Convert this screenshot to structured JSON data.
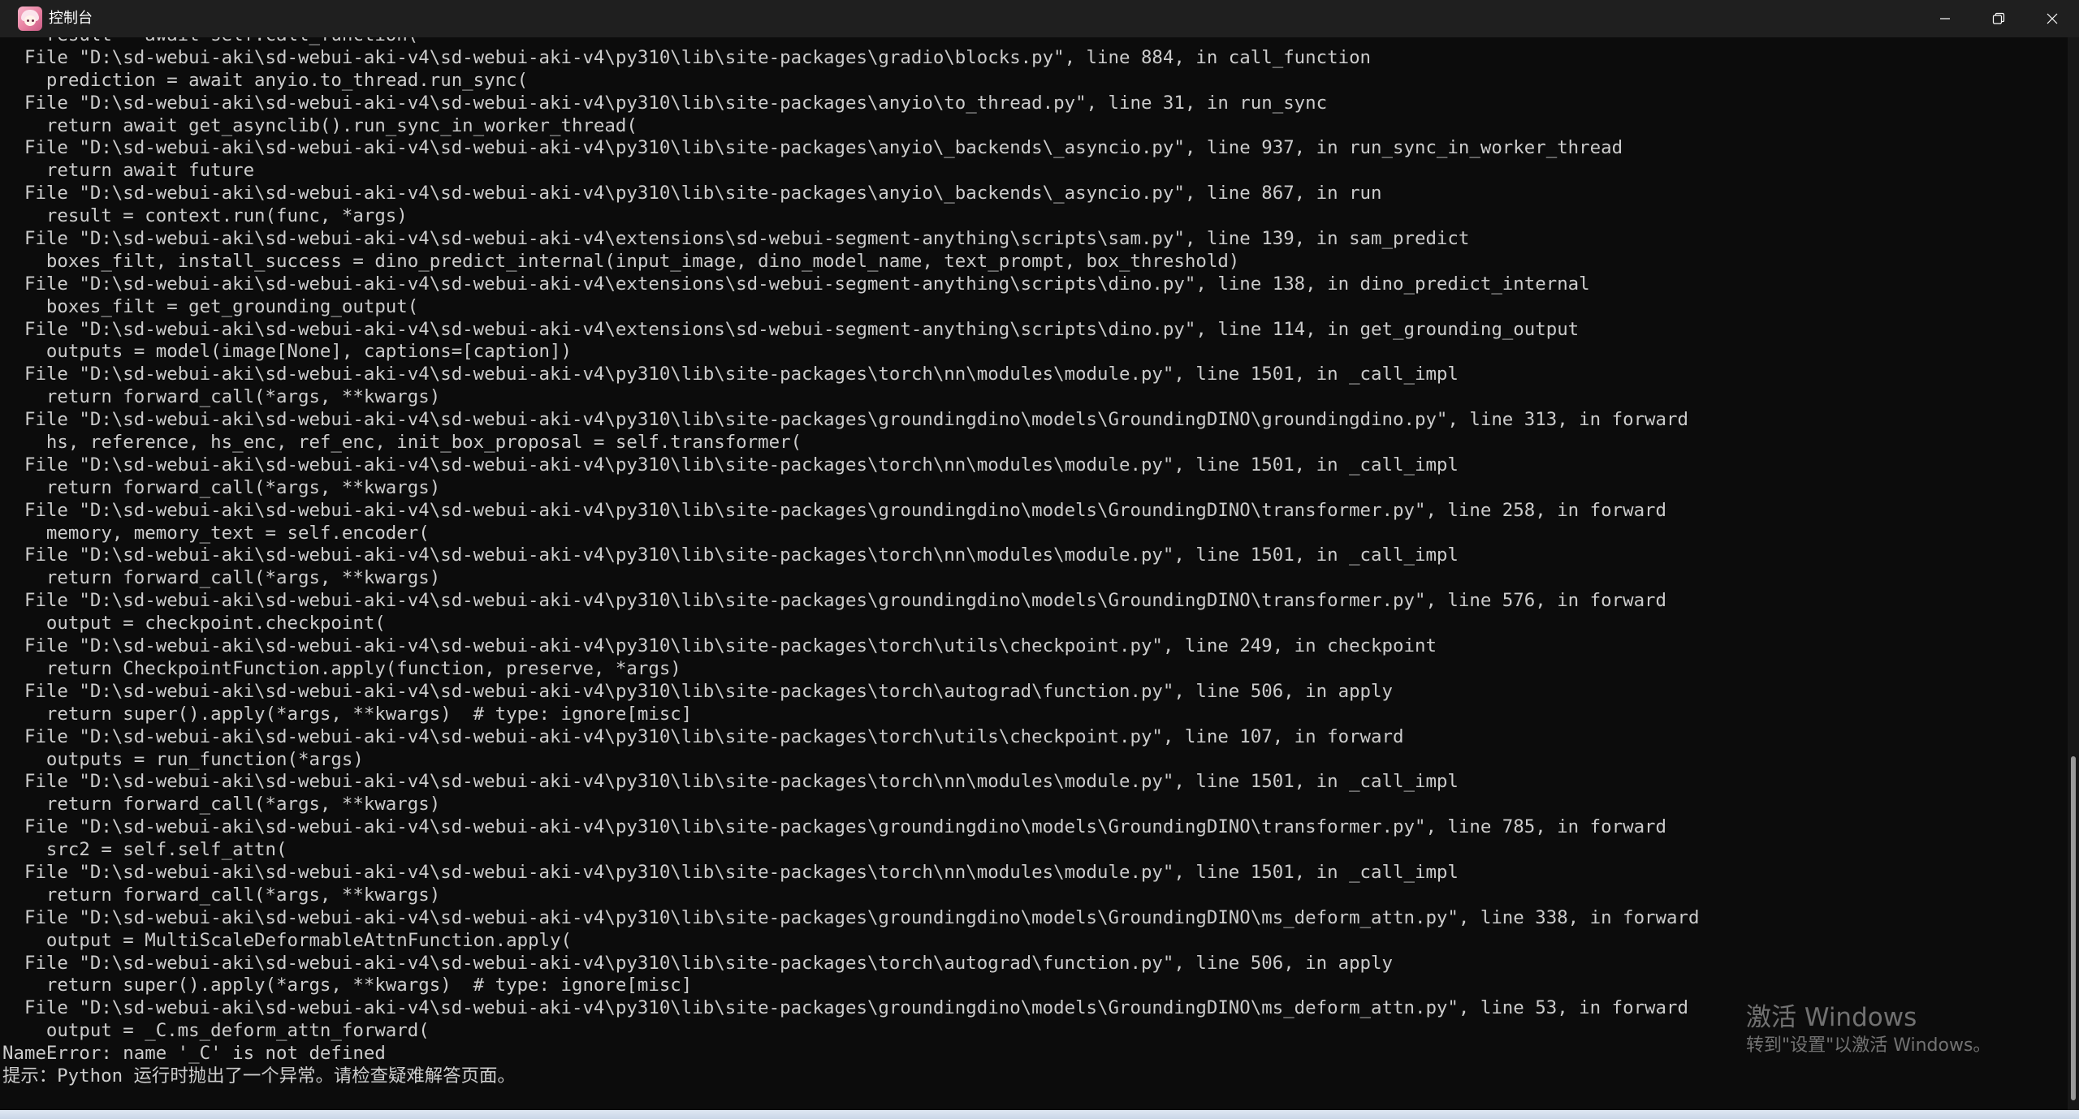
{
  "window": {
    "title": "控制台",
    "app_icon": "anime-avatar-icon",
    "controls": {
      "minimize": "minimize-icon",
      "maximize": "restore-icon",
      "close": "close-icon"
    }
  },
  "console": {
    "lines": [
      "    result = await self.call_function(",
      "  File \"D:\\sd-webui-aki\\sd-webui-aki-v4\\sd-webui-aki-v4\\py310\\lib\\site-packages\\gradio\\blocks.py\", line 884, in call_function",
      "    prediction = await anyio.to_thread.run_sync(",
      "  File \"D:\\sd-webui-aki\\sd-webui-aki-v4\\sd-webui-aki-v4\\py310\\lib\\site-packages\\anyio\\to_thread.py\", line 31, in run_sync",
      "    return await get_asynclib().run_sync_in_worker_thread(",
      "  File \"D:\\sd-webui-aki\\sd-webui-aki-v4\\sd-webui-aki-v4\\py310\\lib\\site-packages\\anyio\\_backends\\_asyncio.py\", line 937, in run_sync_in_worker_thread",
      "    return await future",
      "  File \"D:\\sd-webui-aki\\sd-webui-aki-v4\\sd-webui-aki-v4\\py310\\lib\\site-packages\\anyio\\_backends\\_asyncio.py\", line 867, in run",
      "    result = context.run(func, *args)",
      "  File \"D:\\sd-webui-aki\\sd-webui-aki-v4\\sd-webui-aki-v4\\extensions\\sd-webui-segment-anything\\scripts\\sam.py\", line 139, in sam_predict",
      "    boxes_filt, install_success = dino_predict_internal(input_image, dino_model_name, text_prompt, box_threshold)",
      "  File \"D:\\sd-webui-aki\\sd-webui-aki-v4\\sd-webui-aki-v4\\extensions\\sd-webui-segment-anything\\scripts\\dino.py\", line 138, in dino_predict_internal",
      "    boxes_filt = get_grounding_output(",
      "  File \"D:\\sd-webui-aki\\sd-webui-aki-v4\\sd-webui-aki-v4\\extensions\\sd-webui-segment-anything\\scripts\\dino.py\", line 114, in get_grounding_output",
      "    outputs = model(image[None], captions=[caption])",
      "  File \"D:\\sd-webui-aki\\sd-webui-aki-v4\\sd-webui-aki-v4\\py310\\lib\\site-packages\\torch\\nn\\modules\\module.py\", line 1501, in _call_impl",
      "    return forward_call(*args, **kwargs)",
      "  File \"D:\\sd-webui-aki\\sd-webui-aki-v4\\sd-webui-aki-v4\\py310\\lib\\site-packages\\groundingdino\\models\\GroundingDINO\\groundingdino.py\", line 313, in forward",
      "    hs, reference, hs_enc, ref_enc, init_box_proposal = self.transformer(",
      "  File \"D:\\sd-webui-aki\\sd-webui-aki-v4\\sd-webui-aki-v4\\py310\\lib\\site-packages\\torch\\nn\\modules\\module.py\", line 1501, in _call_impl",
      "    return forward_call(*args, **kwargs)",
      "  File \"D:\\sd-webui-aki\\sd-webui-aki-v4\\sd-webui-aki-v4\\py310\\lib\\site-packages\\groundingdino\\models\\GroundingDINO\\transformer.py\", line 258, in forward",
      "    memory, memory_text = self.encoder(",
      "  File \"D:\\sd-webui-aki\\sd-webui-aki-v4\\sd-webui-aki-v4\\py310\\lib\\site-packages\\torch\\nn\\modules\\module.py\", line 1501, in _call_impl",
      "    return forward_call(*args, **kwargs)",
      "  File \"D:\\sd-webui-aki\\sd-webui-aki-v4\\sd-webui-aki-v4\\py310\\lib\\site-packages\\groundingdino\\models\\GroundingDINO\\transformer.py\", line 576, in forward",
      "    output = checkpoint.checkpoint(",
      "  File \"D:\\sd-webui-aki\\sd-webui-aki-v4\\sd-webui-aki-v4\\py310\\lib\\site-packages\\torch\\utils\\checkpoint.py\", line 249, in checkpoint",
      "    return CheckpointFunction.apply(function, preserve, *args)",
      "  File \"D:\\sd-webui-aki\\sd-webui-aki-v4\\sd-webui-aki-v4\\py310\\lib\\site-packages\\torch\\autograd\\function.py\", line 506, in apply",
      "    return super().apply(*args, **kwargs)  # type: ignore[misc]",
      "  File \"D:\\sd-webui-aki\\sd-webui-aki-v4\\sd-webui-aki-v4\\py310\\lib\\site-packages\\torch\\utils\\checkpoint.py\", line 107, in forward",
      "    outputs = run_function(*args)",
      "  File \"D:\\sd-webui-aki\\sd-webui-aki-v4\\sd-webui-aki-v4\\py310\\lib\\site-packages\\torch\\nn\\modules\\module.py\", line 1501, in _call_impl",
      "    return forward_call(*args, **kwargs)",
      "  File \"D:\\sd-webui-aki\\sd-webui-aki-v4\\sd-webui-aki-v4\\py310\\lib\\site-packages\\groundingdino\\models\\GroundingDINO\\transformer.py\", line 785, in forward",
      "    src2 = self.self_attn(",
      "  File \"D:\\sd-webui-aki\\sd-webui-aki-v4\\sd-webui-aki-v4\\py310\\lib\\site-packages\\torch\\nn\\modules\\module.py\", line 1501, in _call_impl",
      "    return forward_call(*args, **kwargs)",
      "  File \"D:\\sd-webui-aki\\sd-webui-aki-v4\\sd-webui-aki-v4\\py310\\lib\\site-packages\\groundingdino\\models\\GroundingDINO\\ms_deform_attn.py\", line 338, in forward",
      "    output = MultiScaleDeformableAttnFunction.apply(",
      "  File \"D:\\sd-webui-aki\\sd-webui-aki-v4\\sd-webui-aki-v4\\py310\\lib\\site-packages\\torch\\autograd\\function.py\", line 506, in apply",
      "    return super().apply(*args, **kwargs)  # type: ignore[misc]",
      "  File \"D:\\sd-webui-aki\\sd-webui-aki-v4\\sd-webui-aki-v4\\py310\\lib\\site-packages\\groundingdino\\models\\GroundingDINO\\ms_deform_attn.py\", line 53, in forward",
      "    output = _C.ms_deform_attn_forward(",
      "NameError: name '_C' is not defined",
      "提示：Python 运行时抛出了一个异常。请检查疑难解答页面。"
    ]
  },
  "watermark": {
    "title": "激活 Windows",
    "subtitle": "转到\"设置\"以激活 Windows。"
  },
  "colors": {
    "background": "#0c0c0c",
    "titlebar": "#1f1f1f",
    "text": "#cccccc"
  }
}
